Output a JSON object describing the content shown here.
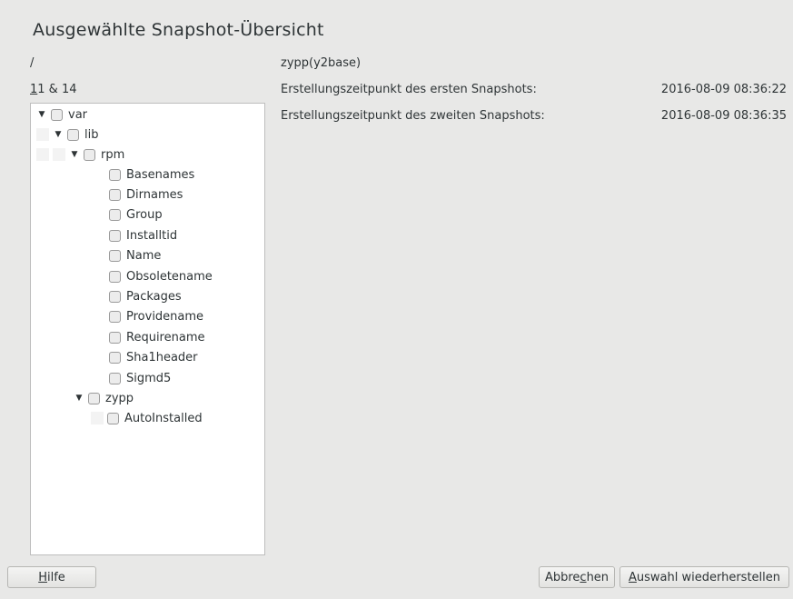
{
  "title": "Ausgewählte Snapshot-Übersicht",
  "path": "/",
  "snapshots": {
    "mnemonic": "1",
    "rest": "1 & 14"
  },
  "source": "zypp(y2base)",
  "info": [
    {
      "label": "Erstellungszeitpunkt des ersten Snapshots:",
      "value": "2016-08-09 08:36:22"
    },
    {
      "label": "Erstellungszeitpunkt des zweiten Snapshots:",
      "value": "2016-08-09 08:36:35"
    }
  ],
  "tree": {
    "var": "var",
    "lib": "lib",
    "rpm": "rpm",
    "rpm_files": [
      "Basenames",
      "Dirnames",
      "Group",
      "Installtid",
      "Name",
      "Obsoletename",
      "Packages",
      "Providename",
      "Requirename",
      "Sha1header",
      "Sigmd5"
    ],
    "zypp": "zypp",
    "zypp_files": [
      "AutoInstalled"
    ]
  },
  "buttons": {
    "help": {
      "mnemonic": "H",
      "rest": "ilfe"
    },
    "cancel": {
      "pre": "Abbre",
      "mnemonic": "c",
      "post": "hen"
    },
    "restore": {
      "mnemonic": "A",
      "rest": "uswahl wiederherstellen"
    }
  },
  "icons": {
    "expanded": "triangle-down-icon"
  }
}
